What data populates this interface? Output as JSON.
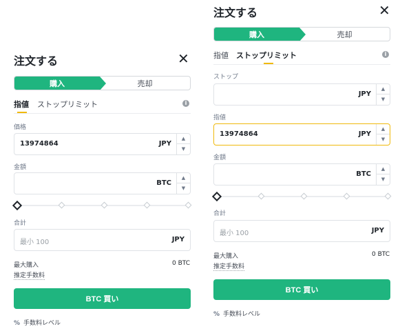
{
  "left": {
    "title": "注文する",
    "close_icon": "close-icon",
    "seg_buy": "購入",
    "seg_sell": "売却",
    "tab_limit": "指値",
    "tab_stoplimit": "ストップリミット",
    "price_label": "価格",
    "price_value": "13974864",
    "price_unit": "JPY",
    "amount_label": "金額",
    "amount_value": "",
    "amount_unit": "BTC",
    "total_label": "合計",
    "total_placeholder": "最小 100",
    "total_unit": "JPY",
    "max_buy_label": "最大購入",
    "max_buy_value": "0 BTC",
    "est_fee_label": "推定手数料",
    "buy_button": "BTC 買い",
    "fee_level": "手数料レベル"
  },
  "right": {
    "title": "注文する",
    "close_icon": "close-icon",
    "seg_buy": "購入",
    "seg_sell": "売却",
    "tab_limit": "指値",
    "tab_stoplimit": "ストップリミット",
    "stop_label": "ストップ",
    "stop_value": "",
    "stop_unit": "JPY",
    "limit_label": "指値",
    "limit_value": "13974864",
    "limit_unit": "JPY",
    "amount_label": "金額",
    "amount_value": "",
    "amount_unit": "BTC",
    "total_label": "合計",
    "total_placeholder": "最小 100",
    "total_unit": "JPY",
    "max_buy_label": "最大購入",
    "max_buy_value": "0 BTC",
    "est_fee_label": "推定手数料",
    "buy_button": "BTC 買い",
    "fee_level": "手数料レベル"
  },
  "slider_value_percent": 0,
  "colors": {
    "accent_green": "#1fb57f",
    "focus_yellow": "#f0b90b",
    "text_dark": "#1e2329"
  }
}
